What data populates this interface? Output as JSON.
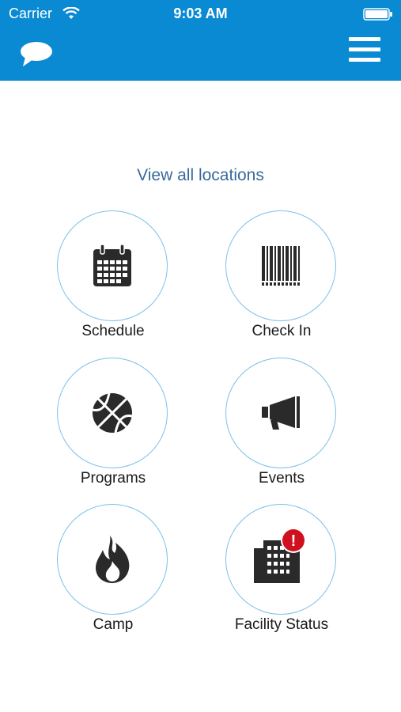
{
  "status_bar": {
    "carrier": "Carrier",
    "time": "9:03 AM"
  },
  "header": {
    "chat_icon": "chat-bubble-icon",
    "menu_icon": "hamburger-menu-icon",
    "background_color": "#0a8ad3"
  },
  "main": {
    "view_all_label": "View all locations",
    "tiles": [
      {
        "label": "Schedule",
        "icon": "calendar-icon"
      },
      {
        "label": "Check In",
        "icon": "barcode-icon"
      },
      {
        "label": "Programs",
        "icon": "basketball-icon"
      },
      {
        "label": "Events",
        "icon": "megaphone-icon"
      },
      {
        "label": "Camp",
        "icon": "flame-icon"
      },
      {
        "label": "Facility Status",
        "icon": "building-alert-icon",
        "alert_badge": "!"
      }
    ]
  },
  "colors": {
    "accent": "#0a8ad3",
    "circle_border": "#7cc1ea",
    "link": "#3a6a9a",
    "alert": "#d0101e"
  }
}
